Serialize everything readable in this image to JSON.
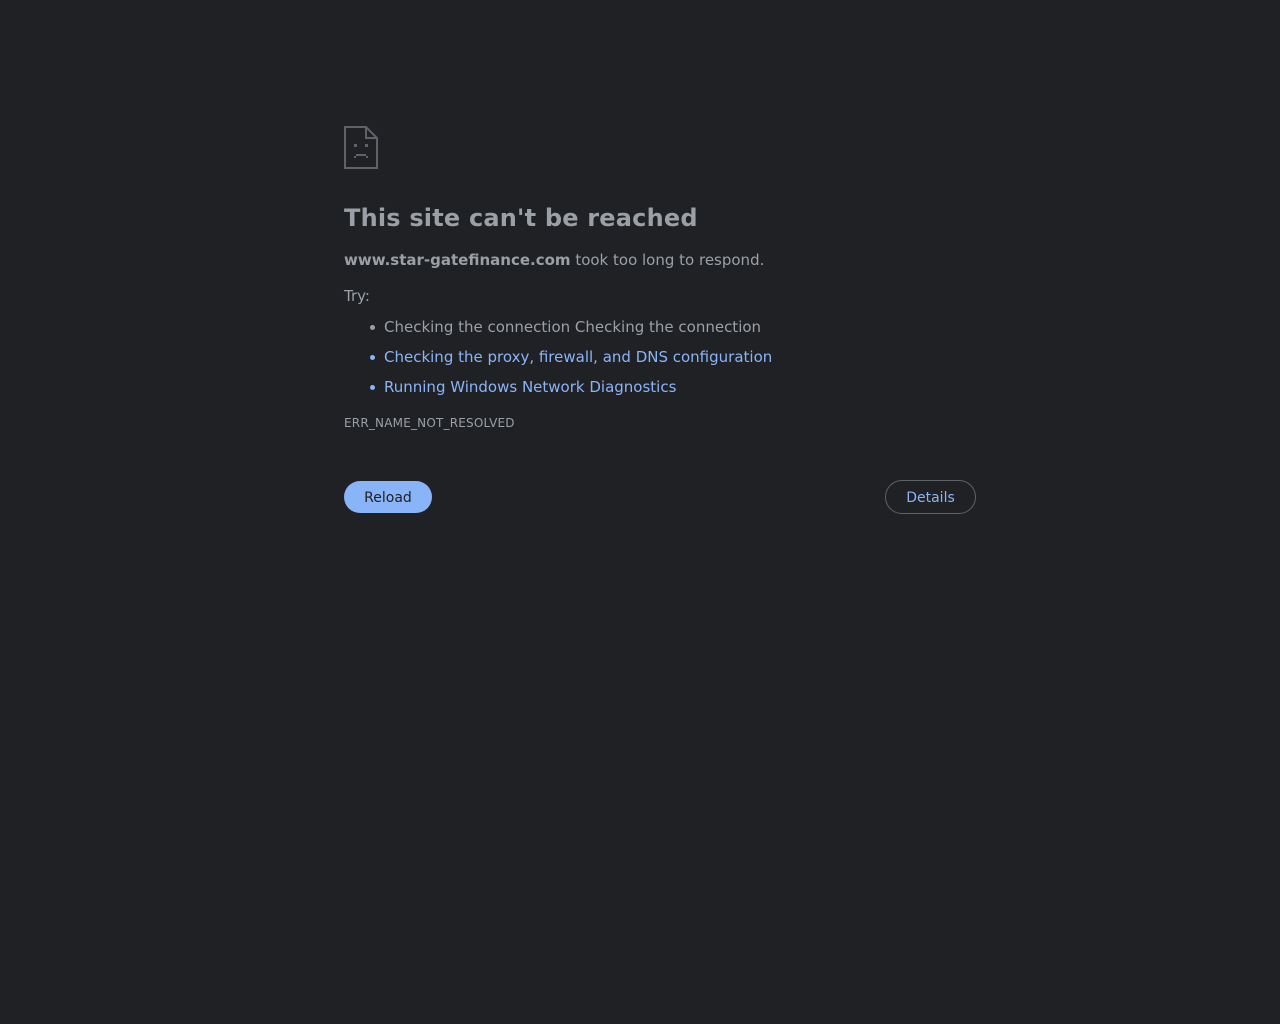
{
  "error_page": {
    "icon": "sad-document-icon",
    "title": "This site can't be reached",
    "domain": "www.star-gatefinance.com",
    "summary_suffix": " took too long to respond.",
    "try_label": "Try:",
    "suggestions": [
      "Checking the connection Checking the connection",
      "Checking the proxy, firewall, and DNS configuration",
      "Running Windows Network Diagnostics"
    ],
    "error_code": "ERR_NAME_NOT_RESOLVED",
    "reload_label": "Reload",
    "details_label": "Details"
  },
  "colors": {
    "background": "#202124",
    "text": "#9aa0a6",
    "link": "#8ab4f8",
    "button_fill": "#8ab4f8",
    "button_outline": "#5f6368"
  }
}
